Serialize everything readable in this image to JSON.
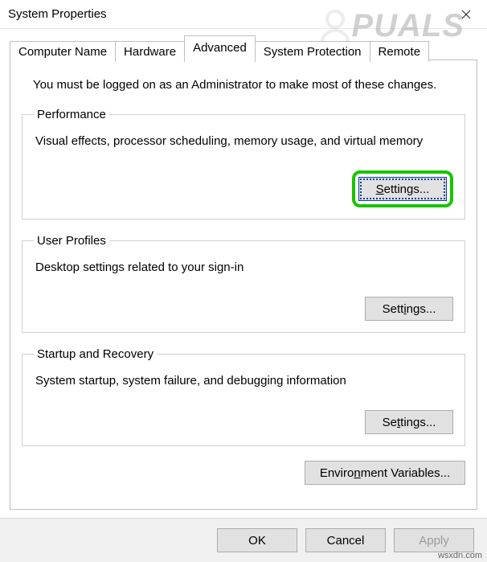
{
  "window": {
    "title": "System Properties"
  },
  "tabs": {
    "computer_name": "Computer Name",
    "hardware": "Hardware",
    "advanced": "Advanced",
    "system_protection": "System Protection",
    "remote": "Remote"
  },
  "intro": "You must be logged on as an Administrator to make most of these changes.",
  "groups": {
    "performance": {
      "legend": "Performance",
      "desc": "Visual effects, processor scheduling, memory usage, and virtual memory",
      "button": "Settings..."
    },
    "profiles": {
      "legend": "User Profiles",
      "desc": "Desktop settings related to your sign-in",
      "button": "Settings..."
    },
    "startup": {
      "legend": "Startup and Recovery",
      "desc": "System startup, system failure, and debugging information",
      "button": "Settings..."
    }
  },
  "env_button": "Environment Variables...",
  "actions": {
    "ok": "OK",
    "cancel": "Cancel",
    "apply": "Apply"
  },
  "watermark": "PUALS",
  "footer": "wsxdn.com"
}
